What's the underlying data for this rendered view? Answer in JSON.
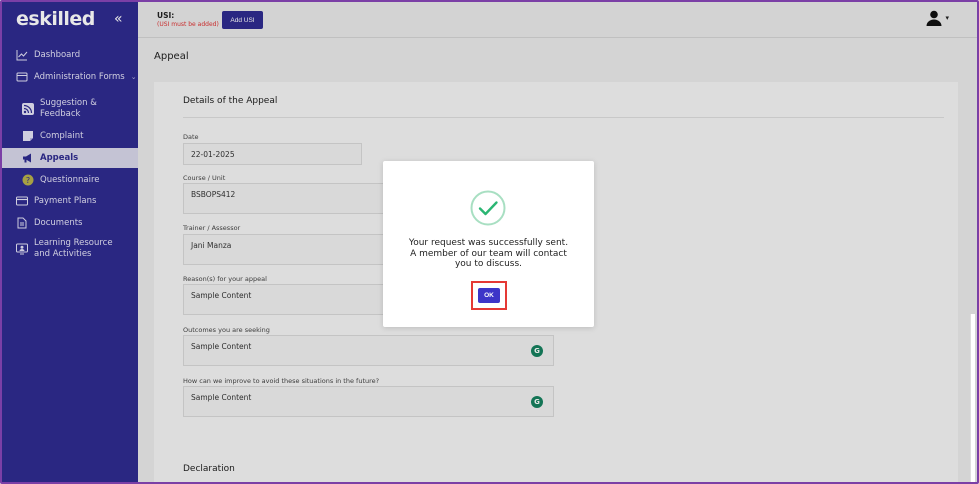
{
  "brand": {
    "logo_text": "eskilled"
  },
  "sidebar": {
    "items": [
      {
        "label": "Dashboard",
        "icon": "chart-line-icon"
      },
      {
        "label": "Administration Forms",
        "icon": "forms-icon"
      },
      {
        "label": "Suggestion & Feedback",
        "icon": "rss-feed-icon"
      },
      {
        "label": "Complaint",
        "icon": "note-icon"
      },
      {
        "label": "Appeals",
        "icon": "megaphone-icon",
        "active": true
      },
      {
        "label": "Questionnaire",
        "icon": "question-circle-icon"
      },
      {
        "label": "Payment Plans",
        "icon": "credit-card-icon"
      },
      {
        "label": "Documents",
        "icon": "document-icon"
      },
      {
        "label": "Learning Resource and Activities",
        "icon": "monitor-user-icon"
      }
    ]
  },
  "topbar": {
    "usi_label": "USI:",
    "usi_note": "(USI must be added)",
    "add_usi_label": "Add USI"
  },
  "main": {
    "page_title": "Appeal",
    "card_title": "Details of the Appeal",
    "fields": [
      {
        "label": "Date",
        "value": "22-01-2025"
      },
      {
        "label": "Course / Unit",
        "value": "BSBOPS412"
      },
      {
        "label": "Trainer / Assessor",
        "value": "Jani Manza"
      },
      {
        "label": "Reason(s) for your appeal",
        "value": "Sample Content"
      },
      {
        "label": "Outcomes you are seeking",
        "value": "Sample Content"
      },
      {
        "label": "How can we improve to avoid these situations in the future?",
        "value": "Sample Content"
      }
    ],
    "declaration_title": "Declaration"
  },
  "modal": {
    "message_line1": "Your request was successfully sent.",
    "message_line2": "A member of our team will contact",
    "message_line3": "you to discuss.",
    "ok_label": "OK"
  },
  "colors": {
    "sidebar_bg": "#2f2b8f",
    "accent": "#3d35c8",
    "success": "#2bb673",
    "highlight_border": "#e53935",
    "warning_text": "#d33333"
  }
}
